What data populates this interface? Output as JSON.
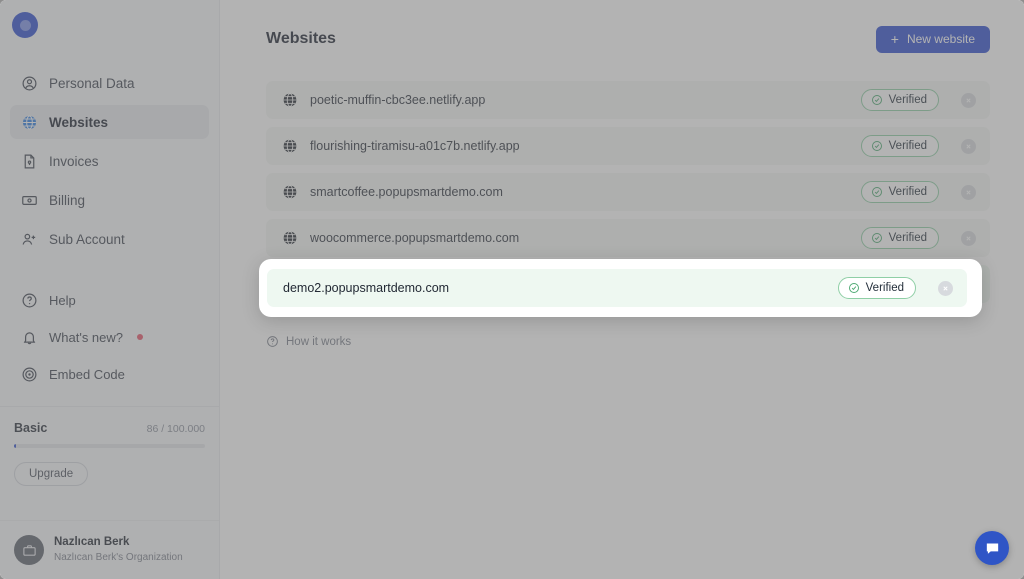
{
  "app": {
    "logo_icon": "popupsmart-logo-icon"
  },
  "sidebar": {
    "nav_primary": [
      {
        "label": "Personal Data",
        "icon": "user-circle-icon",
        "active": false
      },
      {
        "label": "Websites",
        "icon": "globe-icon",
        "active": true
      },
      {
        "label": "Invoices",
        "icon": "document-icon",
        "active": false
      },
      {
        "label": "Billing",
        "icon": "banknote-icon",
        "active": false
      },
      {
        "label": "Sub Account",
        "icon": "user-plus-icon",
        "active": false
      }
    ],
    "nav_secondary": [
      {
        "label": "Help",
        "icon": "question-circle-icon",
        "badge": false
      },
      {
        "label": "What's new?",
        "icon": "bell-icon",
        "badge": true
      },
      {
        "label": "Embed Code",
        "icon": "embed-code-icon",
        "badge": false
      }
    ],
    "plan": {
      "name": "Basic",
      "usage": "86 / 100.000",
      "progress_percent": 1,
      "upgrade_label": "Upgrade"
    },
    "user": {
      "name": "Nazlıcan Berk",
      "organization": "Nazlıcan Berk's Organization",
      "avatar_icon": "briefcase-icon"
    }
  },
  "main": {
    "title": "Websites",
    "new_website_button": "New website",
    "new_website_icon": "plus-icon",
    "how_it_works": "How it works",
    "how_it_works_icon": "question-circle-icon",
    "websites": [
      {
        "url": "poetic-muffin-cbc3ee.netlify.app",
        "status": "Verified",
        "highlighted": false
      },
      {
        "url": "flourishing-tiramisu-a01c7b.netlify.app",
        "status": "Verified",
        "highlighted": false
      },
      {
        "url": "smartcoffee.popupsmartdemo.com",
        "status": "Verified",
        "highlighted": false
      },
      {
        "url": "woocommerce.popupsmartdemo.com",
        "status": "Verified",
        "highlighted": false
      },
      {
        "url": "demo2.popupsmartdemo.com",
        "status": "Verified",
        "highlighted": true
      }
    ],
    "row_icon": "globe-icon",
    "status_icon": "check-circle-icon",
    "remove_icon": "close-icon"
  },
  "chat": {
    "icon": "chat-bubble-icon"
  },
  "colors": {
    "brand_blue": "#2f4fd0",
    "verified_green": "#8fcfa6",
    "highlight_card": "#eef8f1",
    "overlay": "#8d8d8d",
    "sidebar_bg": "#f7f8fa"
  }
}
